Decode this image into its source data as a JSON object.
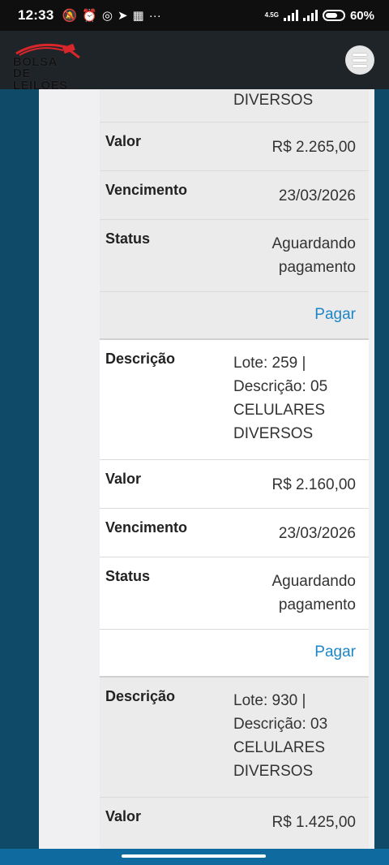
{
  "status_bar": {
    "time": "12:33",
    "network": "4.5G",
    "battery": "60%",
    "notif_icons": [
      "mute-icon",
      "alarm-icon",
      "whatsapp-icon",
      "telegram-icon",
      "calendar-icon",
      "more-icon"
    ]
  },
  "header": {
    "logo_line1": "BOLSA",
    "logo_line2": "DE LEILÕES",
    "brand_color": "#d9262b"
  },
  "labels": {
    "descricao": "Descrição",
    "valor": "Valor",
    "vencimento": "Vencimento",
    "status": "Status",
    "pagar": "Pagar"
  },
  "cards": [
    {
      "descricao_tail": "DIVERSOS",
      "valor": "R$ 2.265,00",
      "vencimento": "23/03/2026",
      "status_line1": "Aguardando",
      "status_line2": "pagamento"
    },
    {
      "descricao_lines": [
        "Lote: 259 |",
        "Descrição: 05",
        "CELULARES",
        "DIVERSOS"
      ],
      "valor": "R$ 2.160,00",
      "vencimento": "23/03/2026",
      "status_line1": "Aguardando",
      "status_line2": "pagamento"
    },
    {
      "descricao_lines": [
        "Lote: 930 |",
        "Descrição: 03",
        "CELULARES",
        "DIVERSOS"
      ],
      "valor": "R$ 1.425,00"
    }
  ]
}
